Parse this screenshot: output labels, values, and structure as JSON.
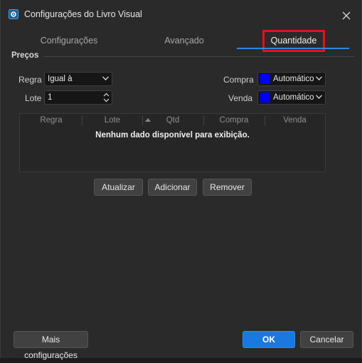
{
  "window": {
    "title": "Configurações do Livro Visual"
  },
  "tabs": [
    {
      "label": "Configurações",
      "active": false
    },
    {
      "label": "Avançado",
      "active": false
    },
    {
      "label": "Quantidade",
      "active": true
    }
  ],
  "section": {
    "label": "Preços"
  },
  "form": {
    "regra_label": "Regra",
    "regra_value": "Igual à",
    "lote_label": "Lote",
    "lote_value": "1",
    "compra_label": "Compra",
    "compra_value": "Automático",
    "compra_color": "#0000ff",
    "venda_label": "Venda",
    "venda_value": "Automático",
    "venda_color": "#0000ff"
  },
  "grid": {
    "columns": [
      "Regra",
      "Lote",
      "Qtd",
      "Compra",
      "Venda"
    ],
    "empty_message": "Nenhum dado disponível para exibição."
  },
  "actions": {
    "update_label": "Atualizar",
    "add_label": "Adicionar",
    "remove_label": "Remover"
  },
  "footer": {
    "more_label": "Mais configurações",
    "ok_label": "OK",
    "cancel_label": "Cancelar"
  },
  "colors": {
    "accent": "#1a79e0",
    "highlight": "#e8101a",
    "background": "#2a2a2a"
  }
}
